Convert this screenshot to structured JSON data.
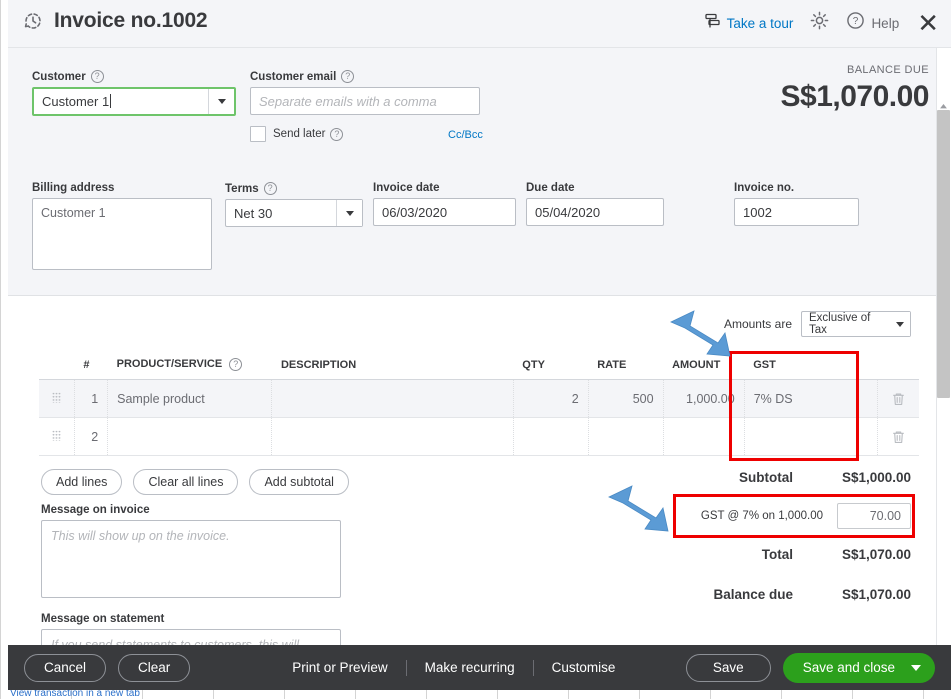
{
  "header": {
    "title": "Invoice no.1002",
    "recurring_icon": "clock-arrow-icon",
    "take_a_tour": "Take a tour",
    "tour_icon": "tour-signpost-icon",
    "gear_icon": "gear-icon",
    "help_icon": "question-circle-icon",
    "help_label": "Help",
    "close_icon": "close-icon",
    "close_glyph": "✕"
  },
  "form": {
    "customer": {
      "label": "Customer",
      "help_icon": "question-circle-icon",
      "value": "Customer 1",
      "caret_icon": "chevron-down-icon"
    },
    "customer_email": {
      "label": "Customer email",
      "help_icon": "question-circle-icon",
      "value": "",
      "placeholder": "Separate emails with a comma"
    },
    "send_later": {
      "label": "Send later",
      "help_icon": "question-circle-icon",
      "checked": false
    },
    "cc_bcc": "Cc/Bcc",
    "balance": {
      "label": "BALANCE DUE",
      "amount": "S$1,070.00"
    },
    "billing_address": {
      "label": "Billing address",
      "value": "Customer 1"
    },
    "terms": {
      "label": "Terms",
      "help_icon": "question-circle-icon",
      "value": "Net 30",
      "caret_icon": "chevron-down-icon"
    },
    "invoice_date": {
      "label": "Invoice date",
      "value": "06/03/2020"
    },
    "due_date": {
      "label": "Due date",
      "value": "05/04/2020"
    },
    "invoice_no": {
      "label": "Invoice no.",
      "value": "1002"
    }
  },
  "lines": {
    "amounts_are_label": "Amounts are",
    "amounts_are_value": "Exclusive of Tax",
    "amounts_are_caret": "chevron-down-icon",
    "columns": [
      "",
      "#",
      "PRODUCT/SERVICE",
      "DESCRIPTION",
      "QTY",
      "RATE",
      "AMOUNT",
      "GST",
      ""
    ],
    "product_help_icon": "question-circle-icon",
    "rows": [
      {
        "drag": "drag-handle-icon",
        "num": "1",
        "product": "Sample product",
        "description": "",
        "qty": "2",
        "rate": "500",
        "amount": "1,000.00",
        "gst": "7% DS",
        "delete": "trash-icon"
      },
      {
        "drag": "drag-handle-icon",
        "num": "2",
        "product": "",
        "description": "",
        "qty": "",
        "rate": "",
        "amount": "",
        "gst": "",
        "delete": "trash-icon"
      }
    ],
    "buttons": [
      "Add lines",
      "Clear all lines",
      "Add subtotal"
    ]
  },
  "messages": {
    "invoice_label": "Message on invoice",
    "invoice_placeholder": "This will show up on the invoice.",
    "statement_label": "Message on statement",
    "statement_placeholder": "If you send statements to customers, this will show up as"
  },
  "totals": {
    "subtotal_label": "Subtotal",
    "subtotal_value": "S$1,000.00",
    "gst_desc": "GST @ 7% on 1,000.00",
    "gst_value": "70.00",
    "total_label": "Total",
    "total_value": "S$1,070.00",
    "balance_due_label": "Balance due",
    "balance_due_value": "S$1,070.00"
  },
  "footer": {
    "cancel": "Cancel",
    "clear": "Clear",
    "print_or_preview": "Print or Preview",
    "make_recurring": "Make recurring",
    "customise": "Customise",
    "save": "Save",
    "save_and_close": "Save and close",
    "save_caret_icon": "chevron-down-icon"
  },
  "background": {
    "link_text": "View transaction in a new tab"
  },
  "annotations": {
    "arrow_1": "blue-arrow-icon",
    "arrow_2": "blue-arrow-icon",
    "box_1": "red-highlight-box",
    "box_2": "red-highlight-box",
    "arrow_color": "#5b9bd5",
    "box_color": "#ee0000"
  },
  "colors": {
    "accent_green": "#2ca01c",
    "link_blue": "#0077c5",
    "footer_dark": "#393a3d",
    "panel_gray": "#f4f5f8"
  }
}
